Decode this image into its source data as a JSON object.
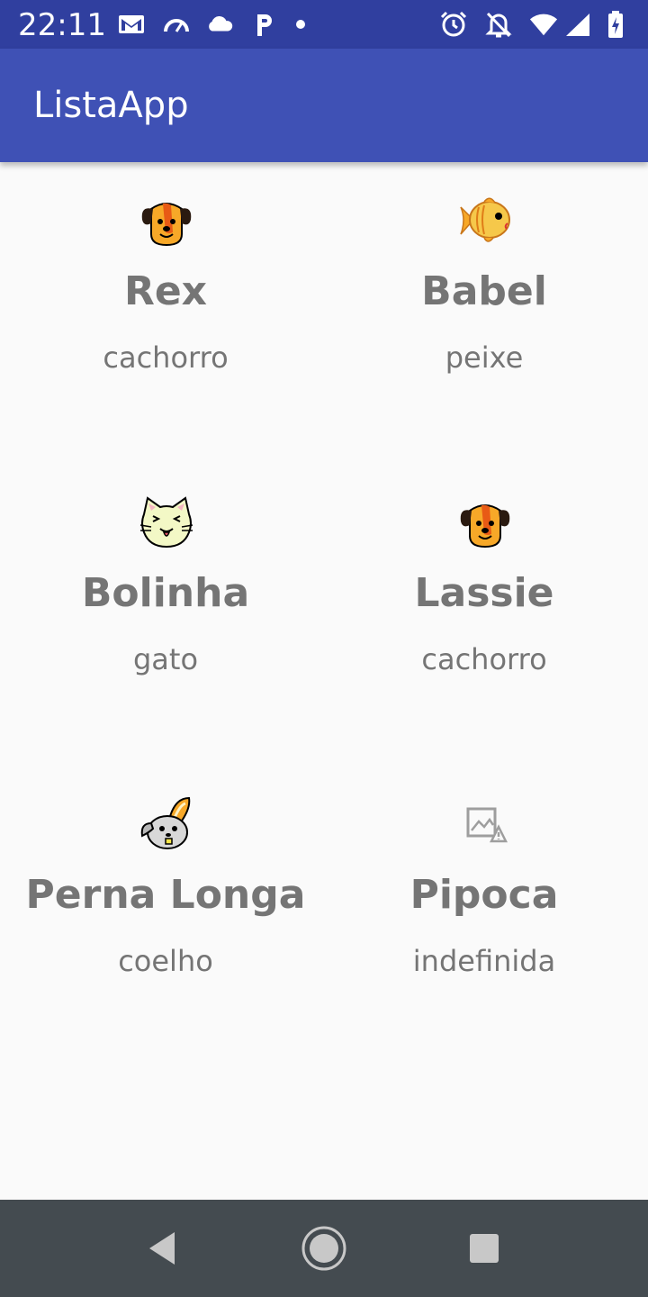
{
  "status_bar": {
    "time": "22:11",
    "icons": [
      "gmail-icon",
      "speedometer-icon",
      "cloud-icon",
      "p-icon",
      "dot-icon",
      "alarm-icon",
      "notifications-off-icon",
      "wifi-icon",
      "signal-icon",
      "battery-icon"
    ]
  },
  "app_bar": {
    "title": "ListaApp"
  },
  "pets": [
    {
      "name": "Rex",
      "type": "cachorro",
      "icon": "dog-icon"
    },
    {
      "name": "Babel",
      "type": "peixe",
      "icon": "fish-icon"
    },
    {
      "name": "Bolinha",
      "type": "gato",
      "icon": "cat-icon"
    },
    {
      "name": "Lassie",
      "type": "cachorro",
      "icon": "dog-icon"
    },
    {
      "name": "Perna Longa",
      "type": "coelho",
      "icon": "rabbit-icon"
    },
    {
      "name": "Pipoca",
      "type": "indefinida",
      "icon": "broken-image-icon"
    }
  ],
  "nav_bar": {
    "buttons": [
      "back-icon",
      "home-icon",
      "recents-icon"
    ]
  },
  "colors": {
    "status_bar": "#303f9f",
    "app_bar": "#3f51b5",
    "text": "#757575",
    "nav_bar": "#444b50"
  }
}
